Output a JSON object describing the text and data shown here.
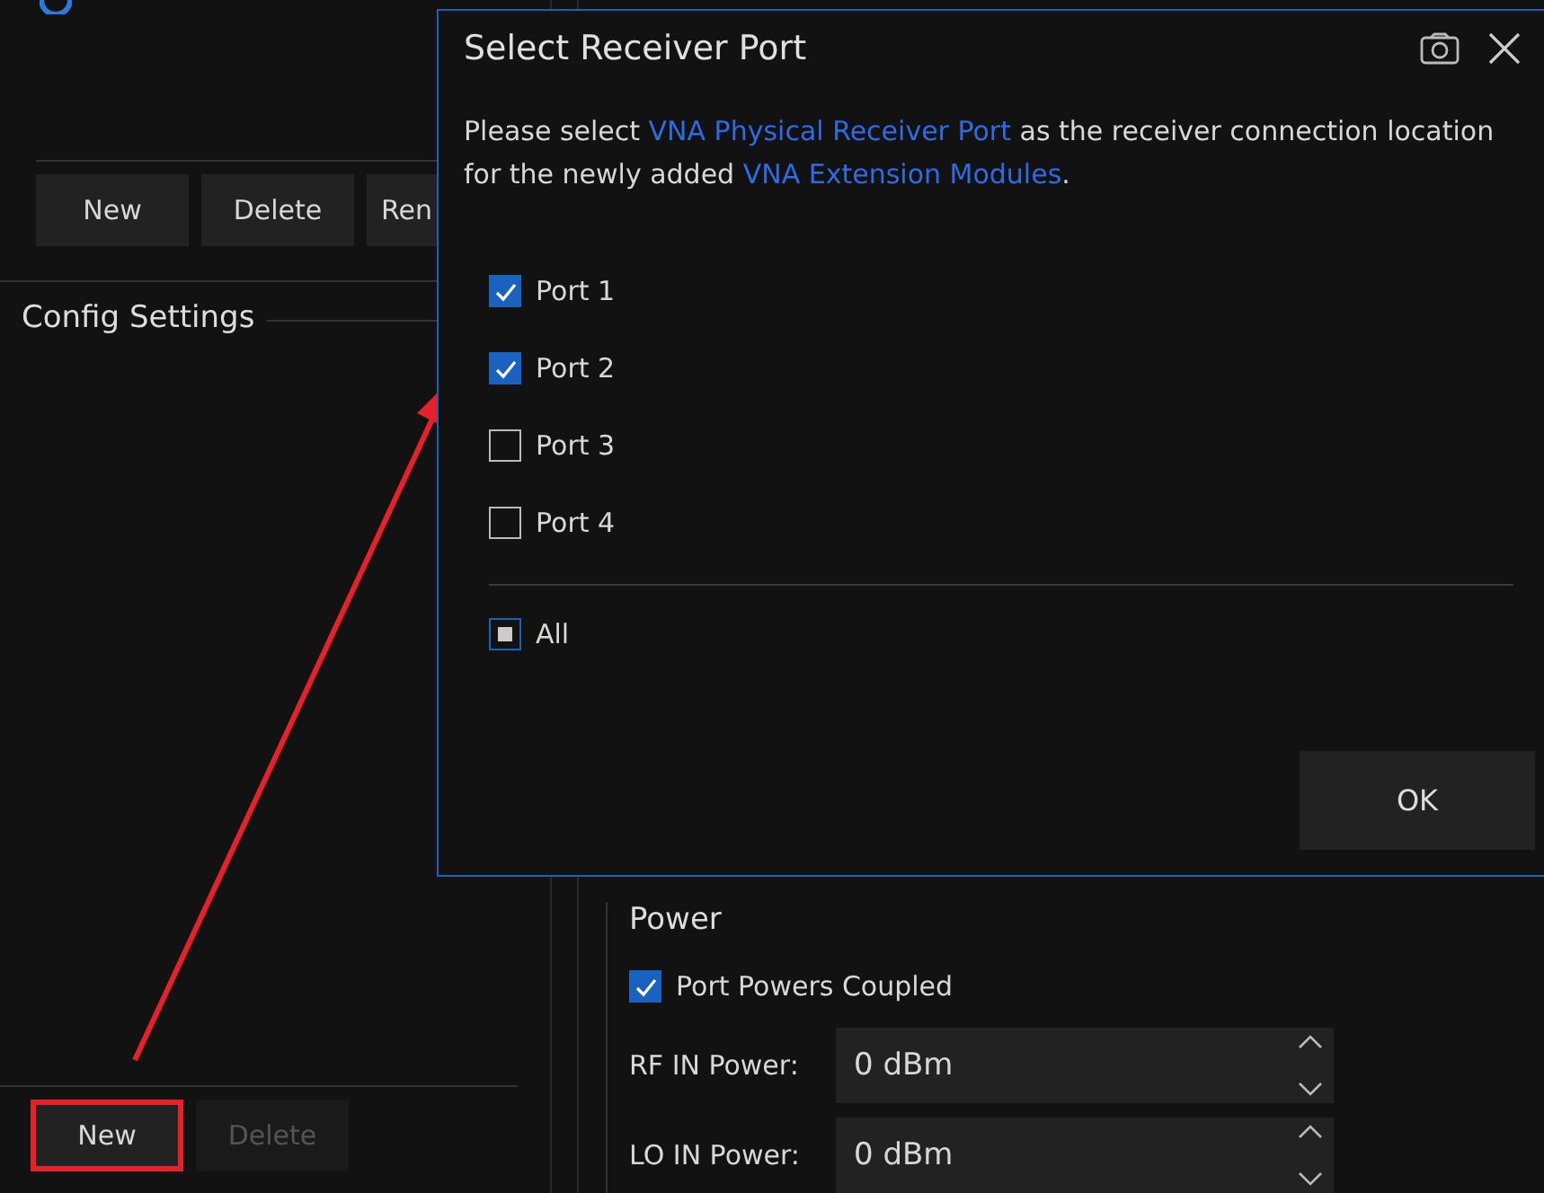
{
  "left_panel": {
    "top_buttons": [
      {
        "label": "New",
        "disabled": false
      },
      {
        "label": "Delete",
        "disabled": false
      },
      {
        "label": "Ren",
        "disabled": false
      }
    ],
    "group_title": "Config Settings",
    "bottom_buttons": [
      {
        "label": "New",
        "disabled": false,
        "highlighted": true
      },
      {
        "label": "Delete",
        "disabled": true,
        "highlighted": false
      }
    ]
  },
  "power": {
    "title": "Power",
    "coupled": {
      "label": "Port Powers Coupled",
      "checked": true
    },
    "fields": [
      {
        "label": "RF IN Power:",
        "value": "0 dBm"
      },
      {
        "label": "LO IN Power:",
        "value": "0 dBm"
      }
    ]
  },
  "dialog": {
    "title": "Select Receiver Port",
    "message": [
      {
        "text": "Please select ",
        "kind": "plain"
      },
      {
        "text": "VNA Physical Receiver Port",
        "kind": "link"
      },
      {
        "text": " as the receiver connection location for the newly added ",
        "kind": "plain"
      },
      {
        "text": "VNA Extension Modules",
        "kind": "link"
      },
      {
        "text": ".",
        "kind": "plain"
      }
    ],
    "ports": [
      {
        "label": "Port 1",
        "checked": true
      },
      {
        "label": "Port 2",
        "checked": true
      },
      {
        "label": "Port 3",
        "checked": false
      },
      {
        "label": "Port 4",
        "checked": false
      }
    ],
    "all": {
      "label": "All",
      "partial": true
    },
    "ok": "OK"
  }
}
